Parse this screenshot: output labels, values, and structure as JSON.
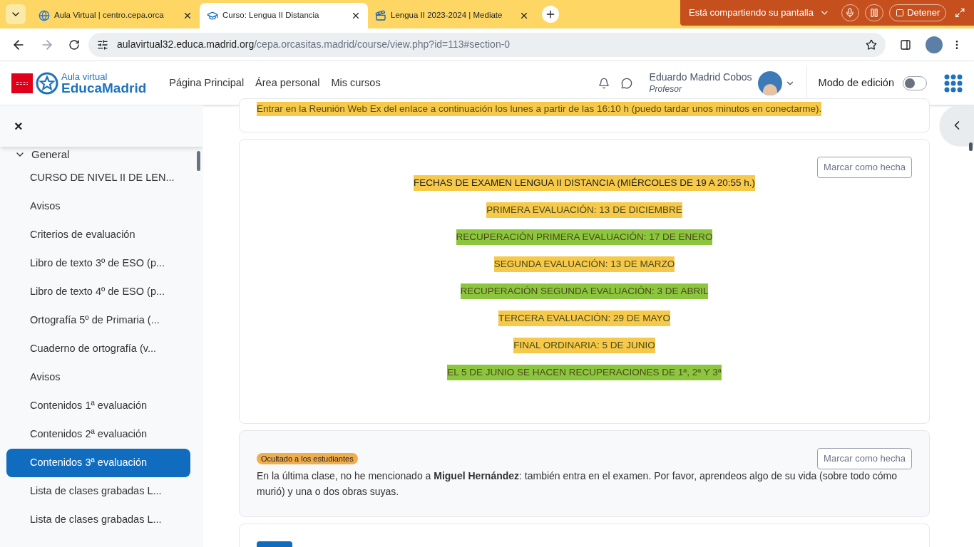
{
  "browser": {
    "tabs": [
      {
        "title": "Aula Virtual | centro.cepa.orca",
        "selected": false,
        "kind": "globe"
      },
      {
        "title": "Curso: Lengua II Distancia",
        "selected": true,
        "kind": "cap"
      },
      {
        "title": "Lengua II 2023-2024 | Mediate",
        "selected": false,
        "kind": "film"
      }
    ],
    "share_bar": {
      "label": "Está compartiendo su pantalla",
      "stop": "Detener"
    },
    "url": {
      "host": "aulavirtual32.educa.madrid.org",
      "path": "/cepa.orcasitas.madrid/course/view.php?id=113#section-0"
    }
  },
  "header": {
    "logo_top": "Aula virtual",
    "logo_bottom": "EducaMadrid",
    "nav": [
      "Página Principal",
      "Área personal",
      "Mis cursos"
    ],
    "user_name": "Eduardo Madrid Cobos",
    "user_role": "Profesor",
    "edit_mode": {
      "label": "Modo de edición",
      "on": false
    }
  },
  "sidebar": {
    "close": "×",
    "section": {
      "title": "General",
      "expanded": true
    },
    "items": [
      {
        "label": "CURSO DE NIVEL II DE LEN...",
        "selected": false
      },
      {
        "label": "Avisos",
        "selected": false
      },
      {
        "label": "Criterios de evaluación",
        "selected": false
      },
      {
        "label": "Libro de texto 3º de ESO (p...",
        "selected": false
      },
      {
        "label": "Libro de texto 4º de ESO (p...",
        "selected": false
      },
      {
        "label": "Ortografía 5º de Primaria (...",
        "selected": false
      },
      {
        "label": "Cuaderno de ortografía (v...",
        "selected": false
      },
      {
        "label": "Avisos",
        "selected": false
      },
      {
        "label": "Contenidos 1ª evaluación",
        "selected": false
      },
      {
        "label": "Contenidos 2ª evaluación",
        "selected": false
      },
      {
        "label": "Contenidos 3ª evaluación",
        "selected": true
      },
      {
        "label": "Lista de clases grabadas L...",
        "selected": false
      },
      {
        "label": "Lista de clases grabadas L...",
        "selected": false
      }
    ]
  },
  "top_card": {
    "text": "Entrar en la Reunión Web Ex del enlace a continuación los lunes a partir de las 16:10 h (puedo tardar unos minutos en conectarme)."
  },
  "exam_card": {
    "button": "Marcar como hecha",
    "lines": [
      {
        "text": "FECHAS DE EXAMEN LENGUA II DISTANCIA (MIÉRCOLES DE 19 A 20:55 h.)",
        "color": "#f6c94a"
      },
      {
        "text": "PRIMERA EVALUACIÓN: 13 DE DICIEMBRE",
        "color": "#f6c94a"
      },
      {
        "text": "RECUPERACIÓN PRIMERA EVALUACIÓN: 17 DE ENERO",
        "color": "#8cc63f"
      },
      {
        "text": "SEGUNDA EVALUACIÓN: 13 DE MARZO",
        "color": "#f6c94a"
      },
      {
        "text": "RECUPERACIÓN SEGUNDA EVALUACIÓN:  3 DE ABRIL",
        "color": "#8cc63f"
      },
      {
        "text": "TERCERA EVALUACIÓN: 29 DE MAYO",
        "color": "#f6c94a"
      },
      {
        "text": "FINAL ORDINARIA: 5 DE JUNIO",
        "color": "#f6c94a"
      },
      {
        "text": "EL 5 DE JUNIO SE HACEN RECUPERACIONES DE 1ª, 2ª Y 3ª",
        "color": "#8cc63f"
      }
    ]
  },
  "hidden_card": {
    "badge": "Ocultado a los estudiantes",
    "button": "Marcar como hecha",
    "text": "En la última clase, no he mencionado a **Miguel Hernández**: también entra en el examen. Por favor, aprendeos algo de su vida (sobre todo cómo murió) y una o dos obras suyas."
  }
}
